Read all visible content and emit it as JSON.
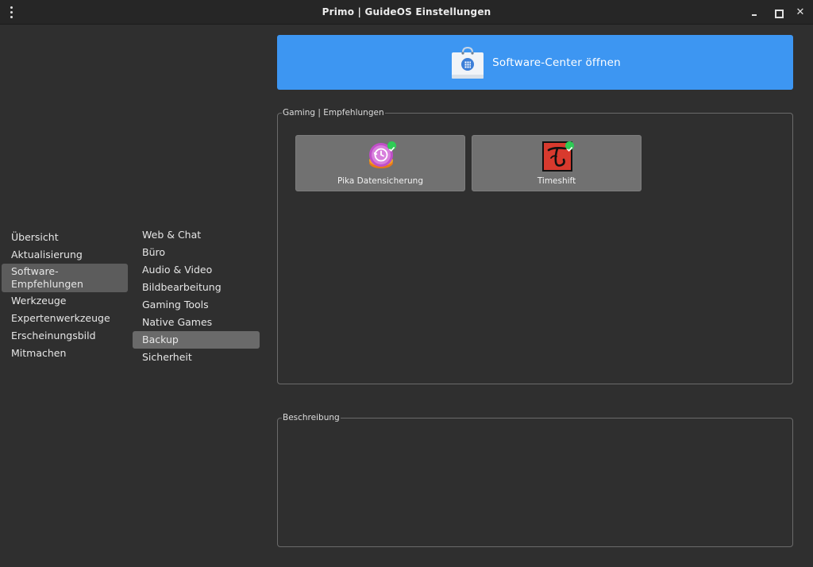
{
  "window": {
    "title": "Primo | GuideOS Einstellungen",
    "close_glyph": "✕"
  },
  "sidebar": {
    "items": [
      {
        "label": "Übersicht"
      },
      {
        "label": "Aktualisierung"
      },
      {
        "label": "Software-Empfehlungen",
        "line1": "Software-",
        "line2": "Empfehlungen",
        "selected": true
      },
      {
        "label": "Werkzeuge"
      },
      {
        "label": "Expertenwerkzeuge"
      },
      {
        "label": "Erscheinungsbild"
      },
      {
        "label": "Mitmachen"
      }
    ]
  },
  "subnav": {
    "items": [
      {
        "label": "Web & Chat"
      },
      {
        "label": "Büro"
      },
      {
        "label": "Audio & Video"
      },
      {
        "label": "Bildbearbeitung"
      },
      {
        "label": "Gaming Tools"
      },
      {
        "label": "Native Games"
      },
      {
        "label": "Backup",
        "selected": true
      },
      {
        "label": "Sicherheit"
      }
    ]
  },
  "software_center": {
    "label": "Software-Center öffnen",
    "icon": "shopping-bag-icon"
  },
  "group_apps": {
    "title": "Gaming | Empfehlungen",
    "apps": [
      {
        "name": "Pika Datensicherung",
        "icon": "pika-backup-icon",
        "installed": true
      },
      {
        "name": "Timeshift",
        "icon": "timeshift-icon",
        "installed": true
      }
    ]
  },
  "group_description": {
    "title": "Beschreibung"
  },
  "colors": {
    "accent": "#3d96f2",
    "background": "#2f2f2f",
    "card": "#717171",
    "installed_badge": "#2ecc55"
  }
}
